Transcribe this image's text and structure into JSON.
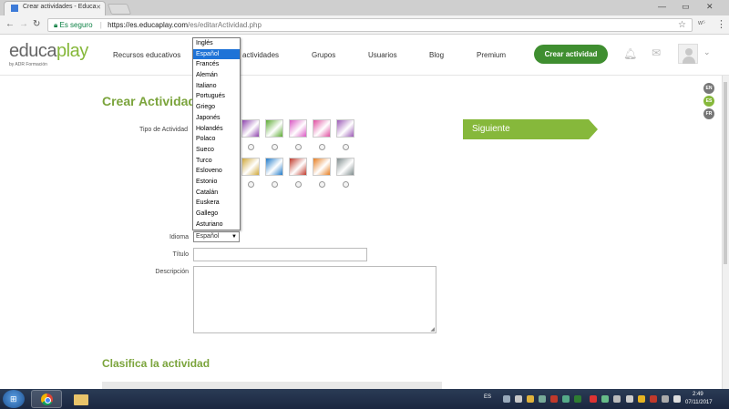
{
  "browser": {
    "tab_title": "Crear actividades - Educa",
    "secure_label": "Es seguro",
    "url_host": "https://es.educaplay.com",
    "url_path": "/es/editarActividad.php"
  },
  "header": {
    "logo_main": "educa",
    "logo_accent": "play",
    "logo_subtitle": "by ADR Formación",
    "nav": [
      "Recursos educativos",
      "actividades",
      "Grupos",
      "Usuarios",
      "Blog",
      "Premium"
    ],
    "create_button": "Crear actividad"
  },
  "page": {
    "title": "Crear Actividad",
    "languages": [
      "EN",
      "ES",
      "FR"
    ],
    "active_language": "ES",
    "labels": {
      "activity_type": "Tipo de Actividad",
      "language": "Idioma",
      "title": "Título",
      "description": "Descripción"
    },
    "next_button": "Siguiente",
    "selected_language": "Español",
    "classify_title": "Clasifica la actividad"
  },
  "dropdown": {
    "options": [
      "Inglés",
      "Español",
      "Francés",
      "Alemán",
      "Italiano",
      "Portugués",
      "Griego",
      "Japonés",
      "Holandés",
      "Polaco",
      "Sueco",
      "Turco",
      "Esloveno",
      "Estonio",
      "Catalán",
      "Euskera",
      "Gallego",
      "Asturiano"
    ],
    "selected_index": 1
  },
  "activity_icons": {
    "row1_colors": [
      "#8e44ad",
      "#5cab32",
      "#d957c2",
      "#e04fa0",
      "#9b59b6"
    ],
    "row2_colors": [
      "#d0a83a",
      "#1f7ac9",
      "#c0392b",
      "#e67e22",
      "#7f8c8d"
    ]
  },
  "taskbar": {
    "lang": "ES",
    "time": "2:49",
    "date": "07/11/2017"
  },
  "colors": {
    "brand_green": "#86b83b",
    "dark_green": "#3f8e30",
    "selection_blue": "#1e73d7"
  }
}
